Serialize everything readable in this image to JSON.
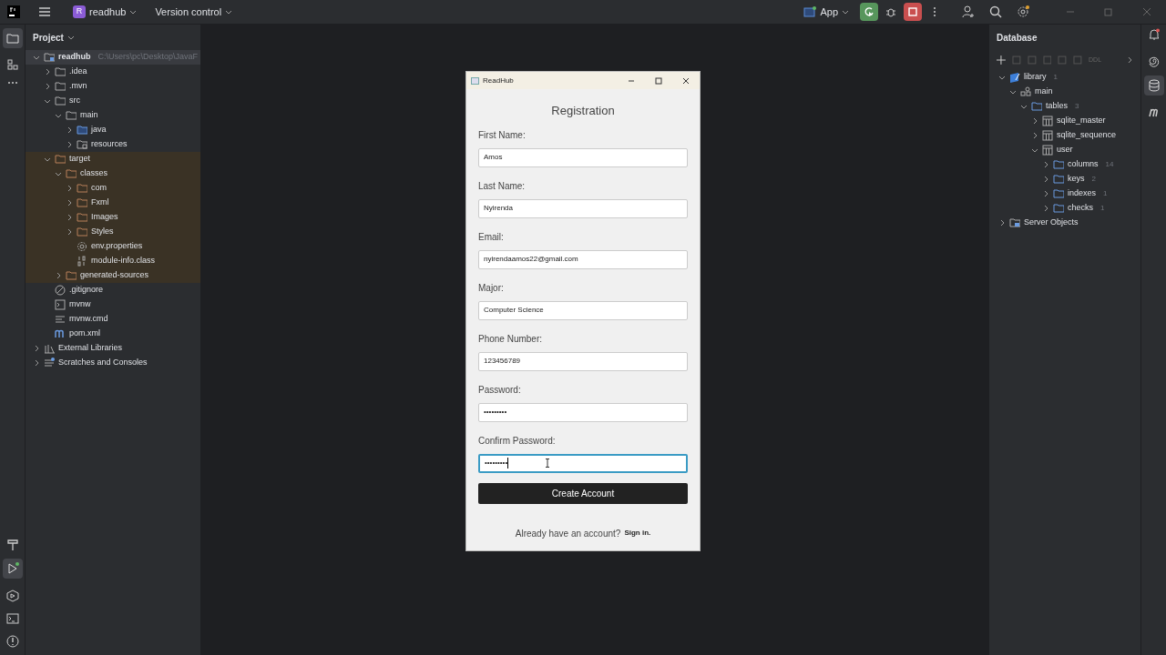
{
  "title_bar": {
    "project_badge": "R",
    "project": "readhub",
    "vcs": "Version control",
    "run_config": "App"
  },
  "project_panel": {
    "title": "Project",
    "tree": [
      {
        "label": "readhub",
        "hint": "C:\\Users\\pc\\Desktop\\JavaF",
        "kind": "module",
        "expanded": true,
        "selected": true,
        "children": [
          {
            "label": ".idea",
            "kind": "folder",
            "expanded": false
          },
          {
            "label": ".mvn",
            "kind": "folder",
            "expanded": false
          },
          {
            "label": "src",
            "kind": "folder",
            "expanded": true,
            "children": [
              {
                "label": "main",
                "kind": "folder",
                "expanded": true,
                "children": [
                  {
                    "label": "java",
                    "kind": "source",
                    "expanded": false
                  },
                  {
                    "label": "resources",
                    "kind": "resources",
                    "expanded": false
                  }
                ]
              }
            ]
          },
          {
            "label": "target",
            "kind": "folder",
            "excluded": true,
            "expanded": true,
            "children": [
              {
                "label": "classes",
                "kind": "folder",
                "excluded": true,
                "expanded": true,
                "children": [
                  {
                    "label": "com",
                    "kind": "folder",
                    "excluded": true,
                    "expanded": false
                  },
                  {
                    "label": "Fxml",
                    "kind": "folder",
                    "excluded": true,
                    "expanded": false
                  },
                  {
                    "label": "Images",
                    "kind": "folder",
                    "excluded": true,
                    "expanded": false
                  },
                  {
                    "label": "Styles",
                    "kind": "folder",
                    "excluded": true,
                    "expanded": false
                  },
                  {
                    "label": "env.properties",
                    "kind": "properties",
                    "excluded": true
                  },
                  {
                    "label": "module-info.class",
                    "kind": "binary",
                    "excluded": true
                  }
                ]
              },
              {
                "label": "generated-sources",
                "kind": "folder",
                "excluded": true,
                "expanded": false
              }
            ]
          },
          {
            "label": ".gitignore",
            "kind": "ignore"
          },
          {
            "label": "mvnw",
            "kind": "script"
          },
          {
            "label": "mvnw.cmd",
            "kind": "text"
          },
          {
            "label": "pom.xml",
            "kind": "maven"
          }
        ]
      },
      {
        "label": "External Libraries",
        "kind": "libraries",
        "expanded": false
      },
      {
        "label": "Scratches and Consoles",
        "kind": "scratches",
        "expanded": false
      }
    ]
  },
  "dialog": {
    "title": "ReadHub",
    "heading": "Registration",
    "fields": [
      {
        "label": "First Name:",
        "value": "Amos",
        "focused": false
      },
      {
        "label": "Last Name:",
        "value": "Nyirenda",
        "focused": false
      },
      {
        "label": "Email:",
        "value": "nyirendaamos22@gmail.com",
        "focused": false
      },
      {
        "label": "Major:",
        "value": "Computer Science",
        "focused": false
      },
      {
        "label": "Phone Number:",
        "value": "123456789",
        "focused": false
      },
      {
        "label": "Password:",
        "value": "•••••••••",
        "focused": false
      },
      {
        "label": "Confirm Password:",
        "value": "•••••••••",
        "focused": true
      }
    ],
    "button": "Create Account",
    "prompt": "Already have an account?",
    "link": "Sign in."
  },
  "database_panel": {
    "title": "Database",
    "toolbar_text": "DDL",
    "tree": [
      {
        "label": "library",
        "count": "1",
        "kind": "datasource",
        "expanded": true,
        "children": [
          {
            "label": "main",
            "kind": "schema",
            "expanded": true,
            "children": [
              {
                "label": "tables",
                "count": "3",
                "kind": "folder",
                "expanded": true,
                "children": [
                  {
                    "label": "sqlite_master",
                    "kind": "table",
                    "expanded": false
                  },
                  {
                    "label": "sqlite_sequence",
                    "kind": "table",
                    "expanded": false
                  },
                  {
                    "label": "user",
                    "kind": "table",
                    "expanded": true,
                    "children": [
                      {
                        "label": "columns",
                        "count": "14",
                        "kind": "folder",
                        "expanded": false
                      },
                      {
                        "label": "keys",
                        "count": "2",
                        "kind": "folder",
                        "expanded": false
                      },
                      {
                        "label": "indexes",
                        "count": "1",
                        "kind": "folder",
                        "expanded": false
                      },
                      {
                        "label": "checks",
                        "count": "1",
                        "kind": "folder",
                        "expanded": false
                      }
                    ]
                  }
                ]
              }
            ]
          }
        ]
      },
      {
        "label": "Server Objects",
        "kind": "server",
        "expanded": false
      }
    ]
  }
}
